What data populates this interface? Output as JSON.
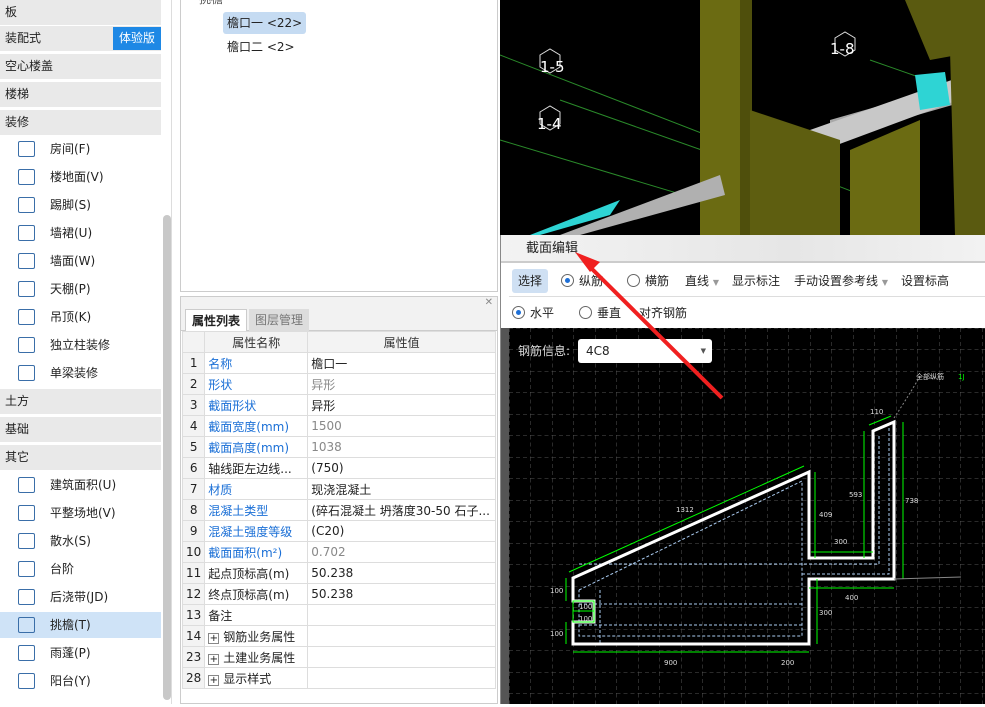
{
  "sidebar": {
    "categories": [
      "板",
      "装配式",
      "空心楼盖",
      "楼梯",
      "装修",
      "土方",
      "基础",
      "其它"
    ],
    "badge": "体验版",
    "decor_items": [
      "房间(F)",
      "楼地面(V)",
      "踢脚(S)",
      "墙裙(U)",
      "墙面(W)",
      "天棚(P)",
      "吊顶(K)",
      "独立柱装修",
      "单梁装修"
    ],
    "other_items": [
      "建筑面积(U)",
      "平整场地(V)",
      "散水(S)",
      "台阶",
      "后浇带(JD)",
      "挑檐(T)",
      "雨蓬(P)",
      "阳台(Y)"
    ]
  },
  "tree": {
    "parent": "挑檐",
    "nodes": [
      "檐口一 <22>",
      "檐口二 <2>"
    ]
  },
  "props": {
    "tabs": [
      "属性列表",
      "图层管理"
    ],
    "headers": [
      "属性名称",
      "属性值"
    ],
    "rows": [
      {
        "n": "1",
        "k": "名称",
        "v": "檐口一"
      },
      {
        "n": "2",
        "k": "形状",
        "v": "异形"
      },
      {
        "n": "3",
        "k": "截面形状",
        "v": "异形"
      },
      {
        "n": "4",
        "k": "截面宽度(mm)",
        "v": "1500"
      },
      {
        "n": "5",
        "k": "截面高度(mm)",
        "v": "1038"
      },
      {
        "n": "6",
        "k": "轴线距左边线...",
        "v": "(750)"
      },
      {
        "n": "7",
        "k": "材质",
        "v": "现浇混凝土"
      },
      {
        "n": "8",
        "k": "混凝土类型",
        "v": "(碎石混凝土 坍落度30-50 石子..."
      },
      {
        "n": "9",
        "k": "混凝土强度等级",
        "v": "(C20)"
      },
      {
        "n": "10",
        "k": "截面面积(m²)",
        "v": "0.702"
      },
      {
        "n": "11",
        "k": "起点顶标高(m)",
        "v": "50.238"
      },
      {
        "n": "12",
        "k": "终点顶标高(m)",
        "v": "50.238"
      },
      {
        "n": "13",
        "k": "备注",
        "v": ""
      },
      {
        "n": "14",
        "k": "钢筋业务属性",
        "v": ""
      },
      {
        "n": "23",
        "k": "土建业务属性",
        "v": ""
      },
      {
        "n": "28",
        "k": "显示样式",
        "v": ""
      }
    ]
  },
  "view3d": {
    "axis_labels": [
      "1-5",
      "1-4",
      "1-8"
    ]
  },
  "dialog": {
    "title": "截面编辑",
    "toolbar1": {
      "select": "选择",
      "longitudinal": "纵筋",
      "transverse": "横筋",
      "line": "直线",
      "show_dims": "显示标注",
      "ref_line": "手动设置参考线",
      "set_elev": "设置标高"
    },
    "toolbar2": {
      "horizontal": "水平",
      "vertical": "垂直",
      "align": "对齐钢筋"
    },
    "rebar_label": "钢筋信息:",
    "rebar_value": "4C8",
    "drawing": {
      "dims": [
        "1312",
        "409",
        "300",
        "593",
        "738",
        "110",
        "400",
        "300",
        "100",
        "100",
        "100",
        "100",
        "900",
        "200"
      ],
      "annotation": "全部纵筋",
      "annotation2": "1J"
    }
  }
}
